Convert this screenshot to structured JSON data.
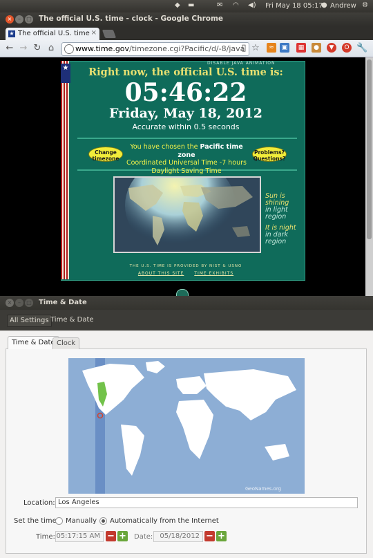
{
  "top_panel": {
    "datetime": "Fri May 18 05:17",
    "user": "Andrew"
  },
  "chrome": {
    "window_title": "The official U.S. time - clock - Google Chrome",
    "tab_title": "The official U.S. time - clock",
    "url_host": "www.time.gov",
    "url_path": "/timezone.cgi?Pacific/d/-8/java"
  },
  "clock_page": {
    "disable_java": "DISABLE JAVA ANIMATION",
    "headline": "Right now, the official U.S. time is:",
    "time": "05:46:22",
    "date": "Friday, May 18, 2012",
    "accuracy": "Accurate within 0.5 seconds",
    "change_timezone_label": "Change timezone",
    "problems_label": "Problems? Questions?",
    "tz_line1_prefix": "You have chosen the ",
    "tz_line1_zone": "Pacific time zone",
    "tz_line2": "Coordinated Universal Time -7 hours",
    "tz_line3": "Daylight Saving Time",
    "sun_shining": "Sun is shining",
    "sun_region": "in light region",
    "it_is_night": "It is night",
    "night_region": "in dark region",
    "provided_by": "THE U.S. TIME IS PROVIDED BY NIST & USNO",
    "about_link": "ABOUT THIS SITE",
    "exhibits_link": "TIME EXHIBITS"
  },
  "time_date_window": {
    "title": "Time & Date",
    "breadcrumb_all": "All Settings",
    "breadcrumb_current": "Time & Date",
    "tabs": [
      "Time & Date",
      "Clock"
    ],
    "map_credit": "GeoNames.org",
    "location_label": "Location:",
    "location_value": "Los Angeles",
    "set_time_label": "Set the time:",
    "option_manual": "Manually",
    "option_auto": "Automatically from the Internet",
    "selected_option": "auto",
    "time_label": "Time:",
    "time_value": "05:17:15 AM",
    "date_label": "Date:",
    "date_value": "05/18/2012"
  },
  "colors": {
    "clock_bg": "#0f6b5a",
    "headline_gold": "#e8e070",
    "button_yellow": "#f1ec3a",
    "chrome_close": "#e2552a",
    "map_ocean": "#8daed5",
    "map_land": "#ffffff",
    "highlight_zone": "#72c24a"
  }
}
